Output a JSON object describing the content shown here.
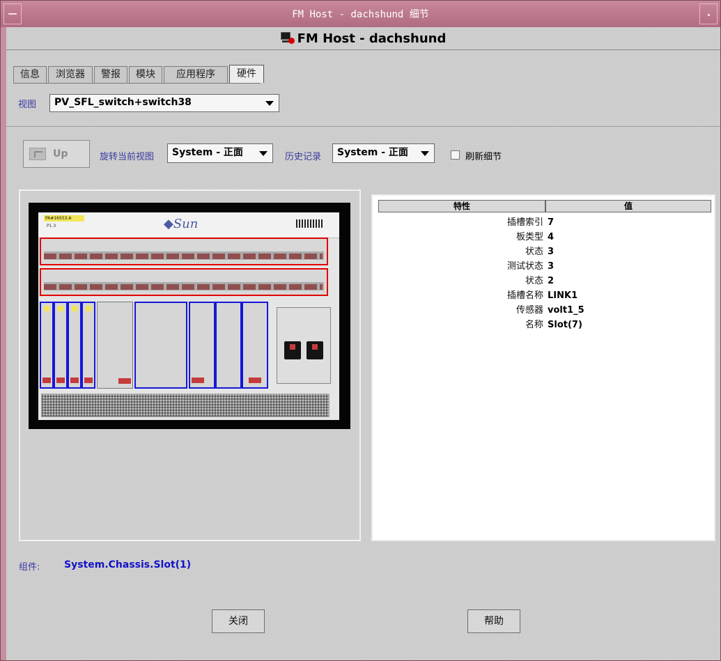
{
  "window": {
    "title": "FM Host - dachshund 细节",
    "header": "FM Host - dachshund"
  },
  "tabs": [
    {
      "label": "信息"
    },
    {
      "label": "浏览器"
    },
    {
      "label": "警报"
    },
    {
      "label": "模块"
    },
    {
      "label": "应用程序"
    },
    {
      "label": "硬件",
      "active": true
    }
  ],
  "view": {
    "label": "视图",
    "selected": "PV_SFL_switch+switch38"
  },
  "toolbar": {
    "up_label": "Up",
    "rotate_label": "旋转当前视图",
    "rotate_selected": "System - 正面",
    "history_label": "历史记录",
    "history_selected": "System - 正面",
    "refresh_label": "刷新细节",
    "refresh_checked": false
  },
  "chassis_image": {
    "brand": "Sun",
    "label": "PA#16553.A",
    "sublabel": "P1.3"
  },
  "properties": {
    "columns": [
      "特性",
      "值"
    ],
    "rows": [
      {
        "name": "插槽索引",
        "value": "7"
      },
      {
        "name": "板类型",
        "value": "4"
      },
      {
        "name": "状态",
        "value": "3"
      },
      {
        "name": "测试状态",
        "value": "3"
      },
      {
        "name": "状态",
        "value": "2"
      },
      {
        "name": "插槽名称",
        "value": "LINK1"
      },
      {
        "name": "传感器",
        "value": "volt1_5"
      },
      {
        "name": "名称",
        "value": "Slot(7)"
      }
    ]
  },
  "component": {
    "label": "组件:",
    "value": "System.Chassis.Slot(1)"
  },
  "buttons": {
    "close": "关闭",
    "help": "帮助"
  },
  "colors": {
    "titlebar": "#b06b80",
    "selection_blue": "#1515d8",
    "selection_red": "#e00000",
    "link_blue": "#1212c8"
  }
}
